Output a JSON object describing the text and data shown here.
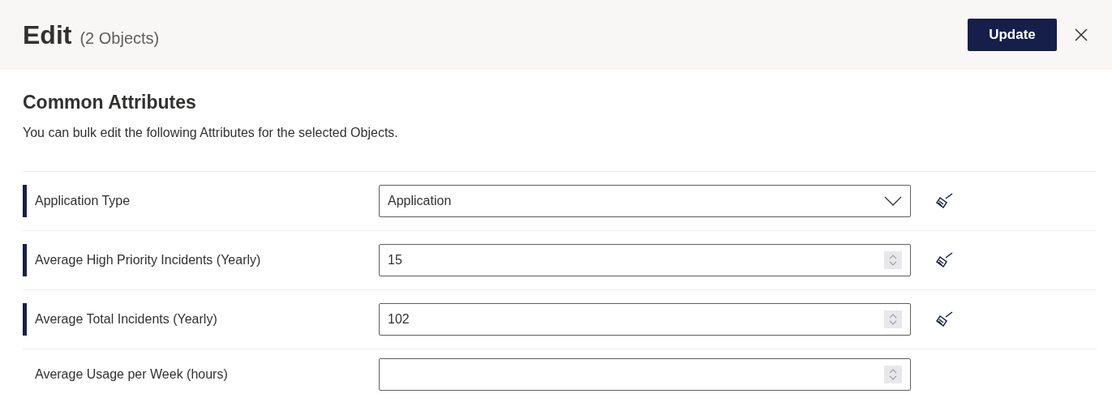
{
  "header": {
    "title": "Edit",
    "subtitle": "(2 Objects)",
    "update_button": "Update"
  },
  "section": {
    "title": "Common Attributes",
    "description": "You can bulk edit the following Attributes for the selected Objects."
  },
  "attributes": [
    {
      "label": "Application Type",
      "kind": "select",
      "value": "Application",
      "modified": true
    },
    {
      "label": "Average High Priority Incidents (Yearly)",
      "kind": "number",
      "value": "15",
      "modified": true
    },
    {
      "label": "Average Total Incidents (Yearly)",
      "kind": "number",
      "value": "102",
      "modified": true
    },
    {
      "label": "Average Usage per Week (hours)",
      "kind": "number",
      "modified": false
    }
  ]
}
